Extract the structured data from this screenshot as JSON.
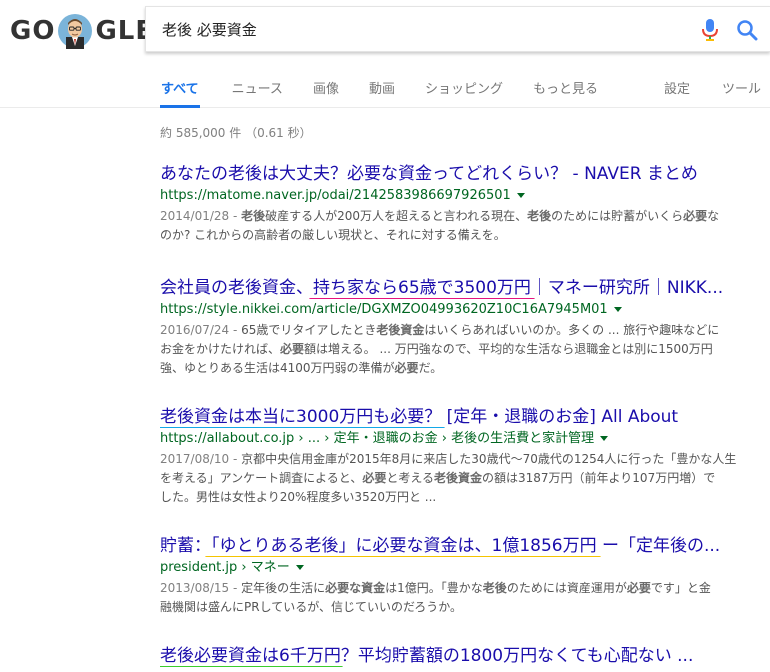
{
  "logo": {
    "left": "GO",
    "right": "GLE"
  },
  "search": {
    "query": "老後 必要資金"
  },
  "tabs": [
    {
      "label": "すべて"
    },
    {
      "label": "ニュース"
    },
    {
      "label": "画像"
    },
    {
      "label": "動画"
    },
    {
      "label": "ショッピング"
    },
    {
      "label": "もっと見る"
    }
  ],
  "tools": {
    "settings": "設定",
    "tools": "ツール"
  },
  "stats": "約 585,000 件 （0.61 秒）",
  "results": [
    {
      "title": "あなたの老後は大丈夫？必要な資金ってどれくらい？ - NAVER まとめ",
      "url": "https://matome.naver.jp/odai/2142583986697926501",
      "date": "2014/01/28 - ",
      "snippet_line1_parts": [
        "",
        "老後",
        "破産する人が200万人を超えると言われる現在、",
        "老後",
        "のためには貯蓄がいくら",
        "必要",
        "な"
      ],
      "snippet_line2": "のか? これからの高齢者の厳しい現状と、それに対する備えを。"
    },
    {
      "title_before": "会社員の老後資金、",
      "title_hl": "持ち家なら65歳で3500万円",
      "title_after": "｜マネー研究所｜NIKK...",
      "url": "https://style.nikkei.com/article/DGXMZO04993620Z10C16A7945M01",
      "date": "2016/07/24 - ",
      "snippet_l1_a": "65歳でリタイアしたとき",
      "snippet_l1_b": "老後資金",
      "snippet_l1_c": "はいくらあればいいのか。多くの ... 旅行や趣味などに",
      "snippet_l2_a": "お金をかけたければ、",
      "snippet_l2_b": "必要",
      "snippet_l2_c": "額は増える。 ... 万円強なので、平均的な生活なら退職金とは別に1500万円",
      "snippet_l3_a": "強、ゆとりある生活は4100万円弱の準備が",
      "snippet_l3_b": "必要",
      "snippet_l3_c": "だ。"
    },
    {
      "title_hl": "老後資金は本当に3000万円も必要？",
      "title_after": " [定年・退職のお金] All About",
      "url": "https://allabout.co.jp › ... › 定年・退職のお金 › 老後の生活費と家計管理",
      "date": "2017/08/10 - ",
      "snippet_l1": "京都中央信用金庫が2015年8月に来店した30歳代〜70歳代の1254人に行った「豊かな人生",
      "snippet_l2_a": "を考える」アンケート調査によると、",
      "snippet_l2_b": "必要",
      "snippet_l2_c": "と考える",
      "snippet_l2_d": "老後資金",
      "snippet_l2_e": "の額は3187万円（前年より107万円増）で",
      "snippet_l3": "した。男性は女性より20%程度多い3520万円と ..."
    },
    {
      "title_before": "貯蓄：",
      "title_hl": "「ゆとりある老後」に必要な資金は、1億1856万円",
      "title_after": " ー「定年後の...",
      "url": "president.jp › マネー",
      "date": "2013/08/15 - ",
      "snippet_l1_a": "定年後の生活に",
      "snippet_l1_b": "必要な資金",
      "snippet_l1_c": "は1億円。「豊かな",
      "snippet_l1_d": "老後",
      "snippet_l1_e": "のためには資産運用が",
      "snippet_l1_f": "必要",
      "snippet_l1_g": "です」と金",
      "snippet_l2": "融機関は盛んにPRしているが、信じていいのだろうか。"
    },
    {
      "title_hl": "老後必要資金は6千万円",
      "title_after": "？平均貯蓄額の1800万円なくても心配ない ..."
    }
  ],
  "colors": {
    "link": "#1a0dab",
    "url": "#006621",
    "underline_pink": "#e6127f",
    "underline_blue": "#13a8e8",
    "underline_yellow": "#f5c400",
    "underline_green": "#3ccd2c",
    "tab_active": "#1a73e8"
  }
}
